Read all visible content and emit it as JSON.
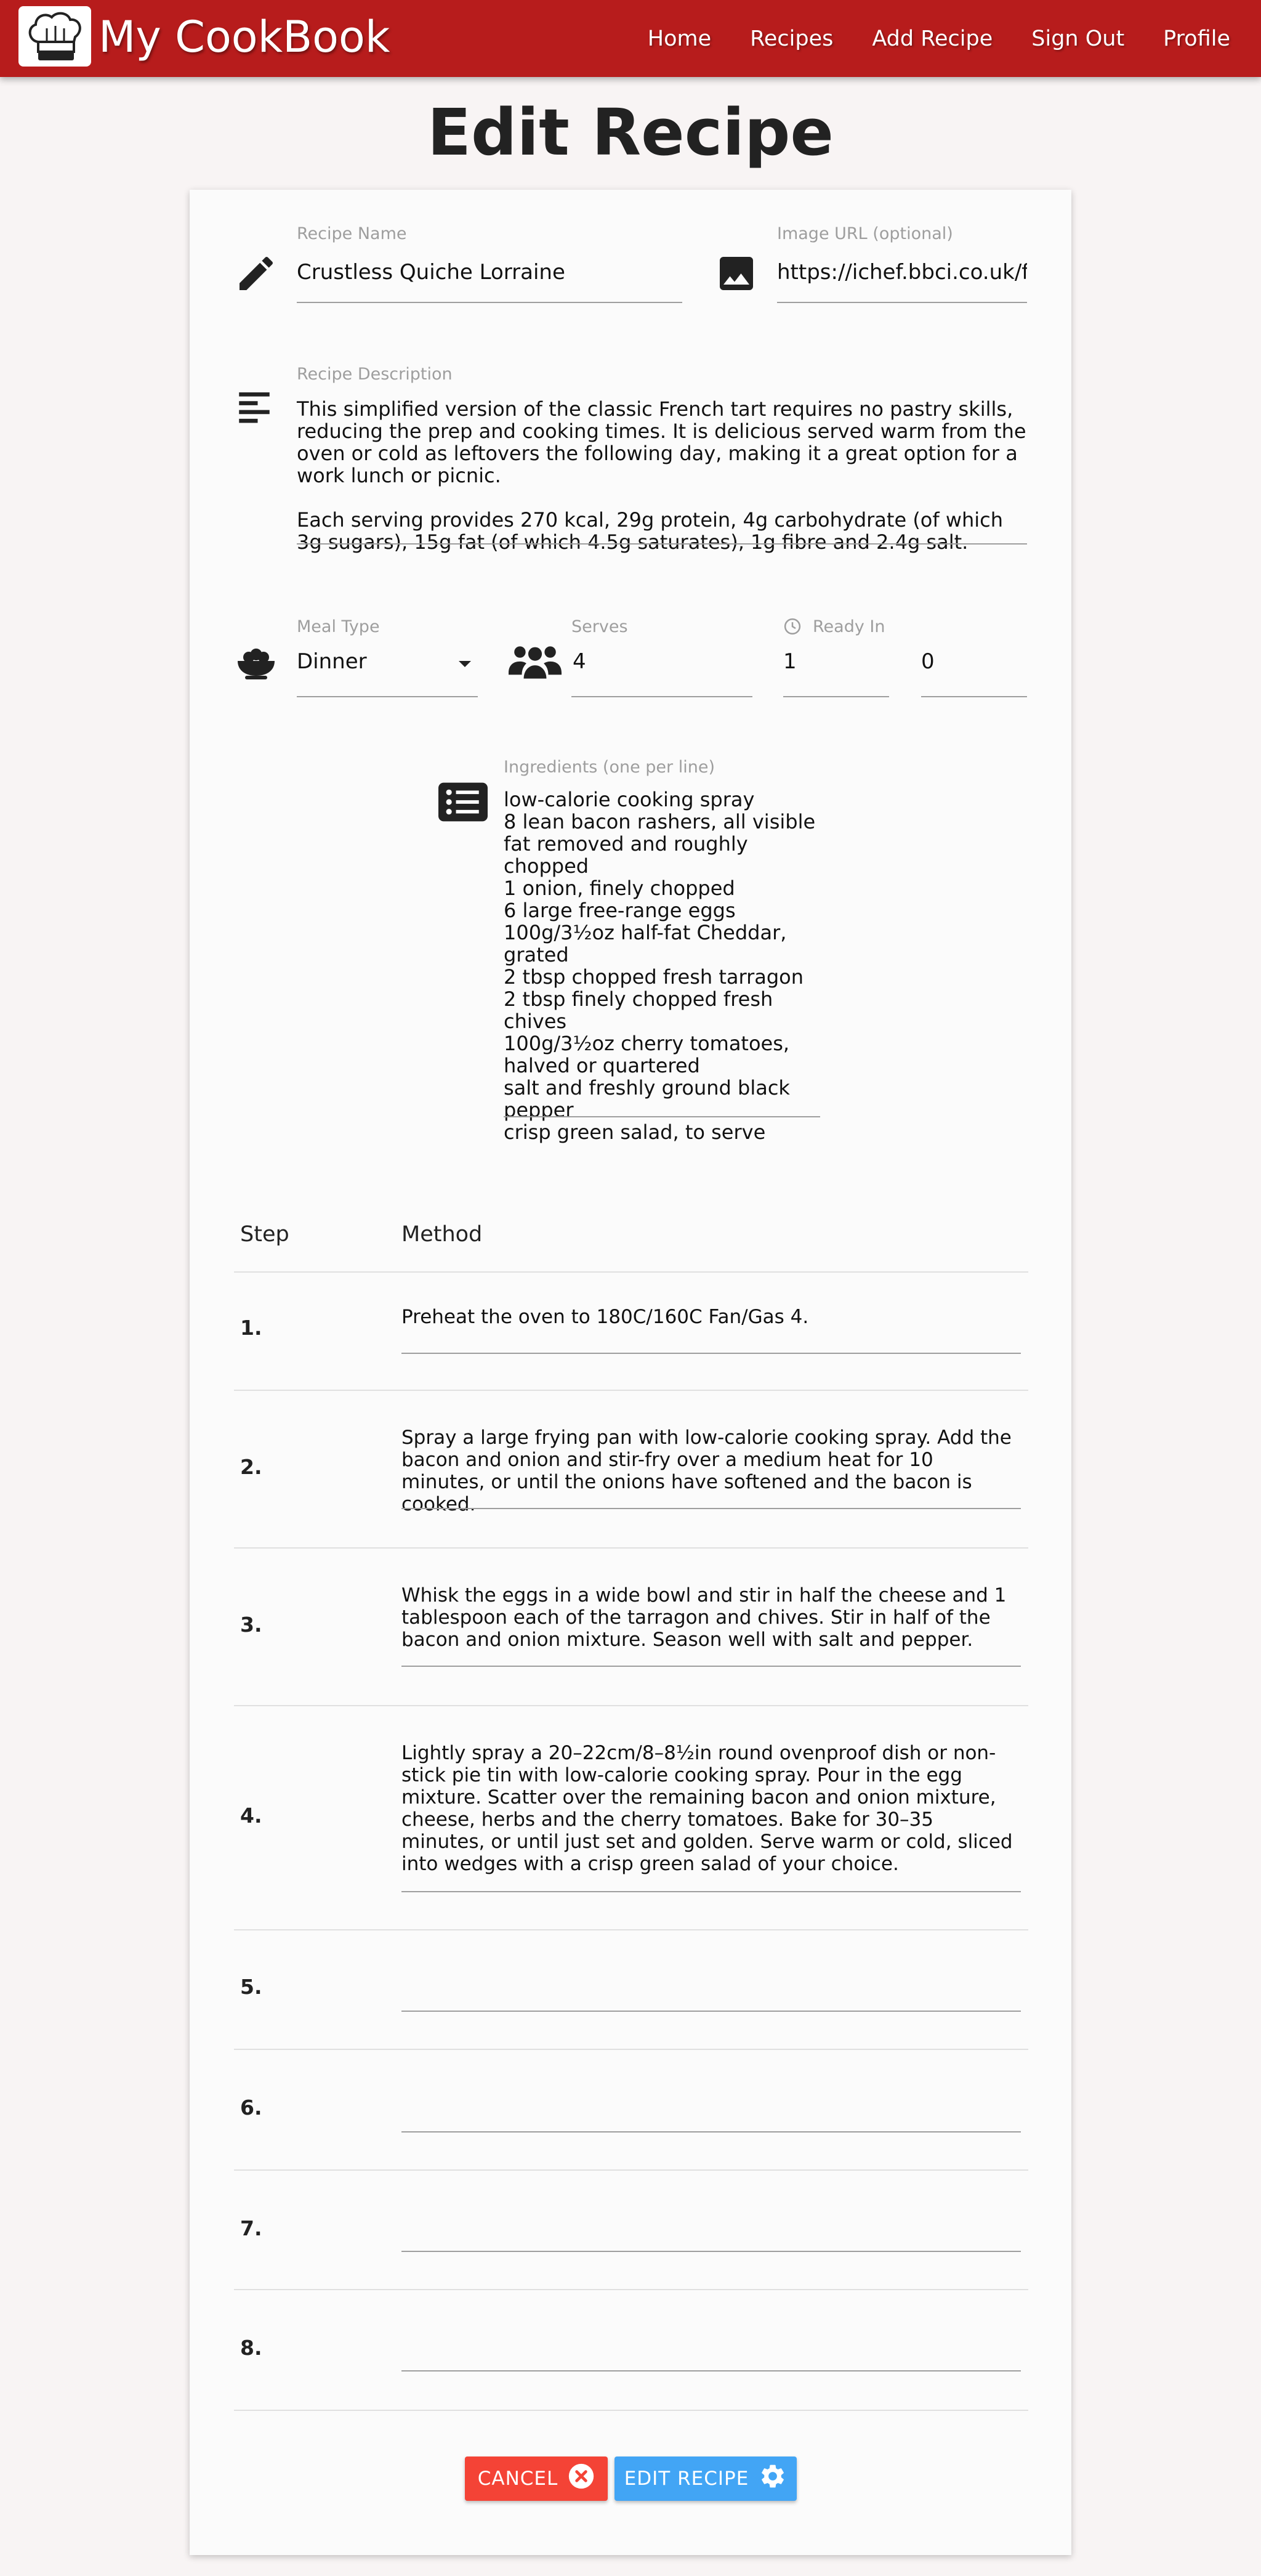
{
  "nav": {
    "brand": "My CookBook",
    "links": [
      "Home",
      "Recipes",
      "Add Recipe",
      "Sign Out",
      "Profile"
    ]
  },
  "page": {
    "title": "Edit Recipe"
  },
  "form": {
    "recipe_name": {
      "label": "Recipe Name",
      "value": "Crustless Quiche Lorraine",
      "icon": "pencil-icon"
    },
    "image_url": {
      "label": "Image URL (optional)",
      "value": "https://ichef.bbci.co.uk/food",
      "icon": "image-icon"
    },
    "description": {
      "label": "Recipe Description",
      "icon": "align-left-icon",
      "value": "This simplified version of the classic French tart requires no pastry skills, reducing the prep and cooking times. It is delicious served warm from the oven or cold as leftovers the following day, making it a great option for a work lunch or picnic.\n\nEach serving provides 270 kcal, 29g protein, 4g carbohydrate (of which 3g sugars), 15g fat (of which 4.5g saturates), 1g fibre and 2.4g salt."
    },
    "meal_type": {
      "label": "Meal Type",
      "value": "Dinner",
      "icon": "bowl-icon"
    },
    "serves": {
      "label": "Serves",
      "value": "4",
      "icon": "users-icon"
    },
    "ready_in": {
      "label": "Ready In",
      "hours": "1",
      "minutes": "0",
      "icon": "clock-icon"
    },
    "ingredients": {
      "label": "Ingredients (one per line)",
      "icon": "list-icon",
      "value": "low-calorie cooking spray\n8 lean bacon rashers, all visible fat removed and roughly chopped\n1 onion, finely chopped\n6 large free-range eggs\n100g/3½oz half-fat Cheddar, grated\n2 tbsp chopped fresh tarragon\n2 tbsp finely chopped fresh chives\n100g/3½oz cherry tomatoes, halved or quartered\nsalt and freshly ground black pepper\ncrisp green salad, to serve"
    }
  },
  "method_table": {
    "headers": {
      "step": "Step",
      "method": "Method"
    },
    "rows": [
      {
        "step": "1.",
        "text": "Preheat the oven to 180C/160C Fan/Gas 4."
      },
      {
        "step": "2.",
        "text": "Spray a large frying pan with low-calorie cooking spray. Add the bacon and onion and stir-fry over a medium heat for 10 minutes, or until the onions have softened and the bacon is cooked."
      },
      {
        "step": "3.",
        "text": "Whisk the eggs in a wide bowl and stir in half the cheese and 1 tablespoon each of the tarragon and chives. Stir in half of the bacon and onion mixture. Season well with salt and pepper."
      },
      {
        "step": "4.",
        "text": "Lightly spray a 20–22cm/8–8½in round ovenproof dish or non-stick pie tin with low-calorie cooking spray. Pour in the egg mixture. Scatter over the remaining bacon and onion mixture, cheese, herbs and the cherry tomatoes. Bake for 30–35 minutes, or until just set and golden. Serve warm or cold, sliced into wedges with a crisp green salad of your choice."
      },
      {
        "step": "5.",
        "text": ""
      },
      {
        "step": "6.",
        "text": ""
      },
      {
        "step": "7.",
        "text": ""
      },
      {
        "step": "8.",
        "text": ""
      }
    ]
  },
  "buttons": {
    "cancel": {
      "label": "CANCEL",
      "icon": "close-circle-icon"
    },
    "edit": {
      "label": "EDIT RECIPE",
      "icon": "gear-icon"
    }
  },
  "colors": {
    "navbar": "#b71c1c",
    "cancel": "#f44336",
    "edit": "#42a5f5",
    "background": "#f8f4f4"
  }
}
